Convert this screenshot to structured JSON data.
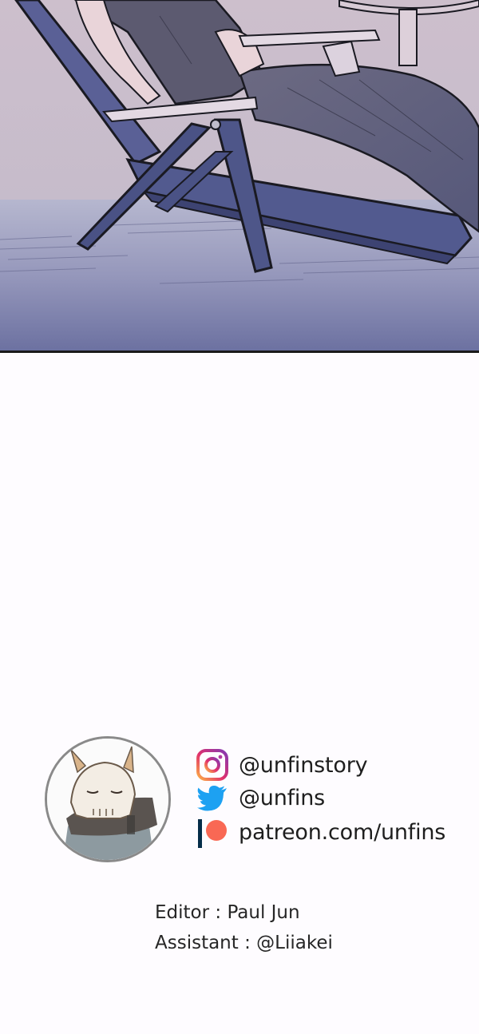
{
  "panel": {
    "scene": "woman-reclining-on-deck-chair",
    "colors": {
      "sky_top": "#cabcc9",
      "sky_bottom": "#c9bdc8",
      "floor_top": "#b3b4cc",
      "floor_bottom": "#6e73a0",
      "chair": "#525a8f",
      "clothing": "#5f5f78",
      "skin": "#e9d4d9",
      "line": "#1a1a22"
    }
  },
  "credits": {
    "avatar": {
      "name": "author-avatar",
      "character": "horned-skull-mask-character"
    },
    "social": [
      {
        "platform": "instagram",
        "icon": "instagram-icon",
        "handle": "@unfinstory",
        "color": "#c13584"
      },
      {
        "platform": "twitter",
        "icon": "twitter-bird-icon",
        "handle": "@unfins",
        "color": "#1da1f2"
      },
      {
        "platform": "patreon",
        "icon": "patreon-icon",
        "handle": "patreon.com/unfins",
        "color": "#f96854"
      }
    ],
    "editor": "Editor : Paul Jun",
    "assistant": "Assistant : @Liiakei"
  }
}
